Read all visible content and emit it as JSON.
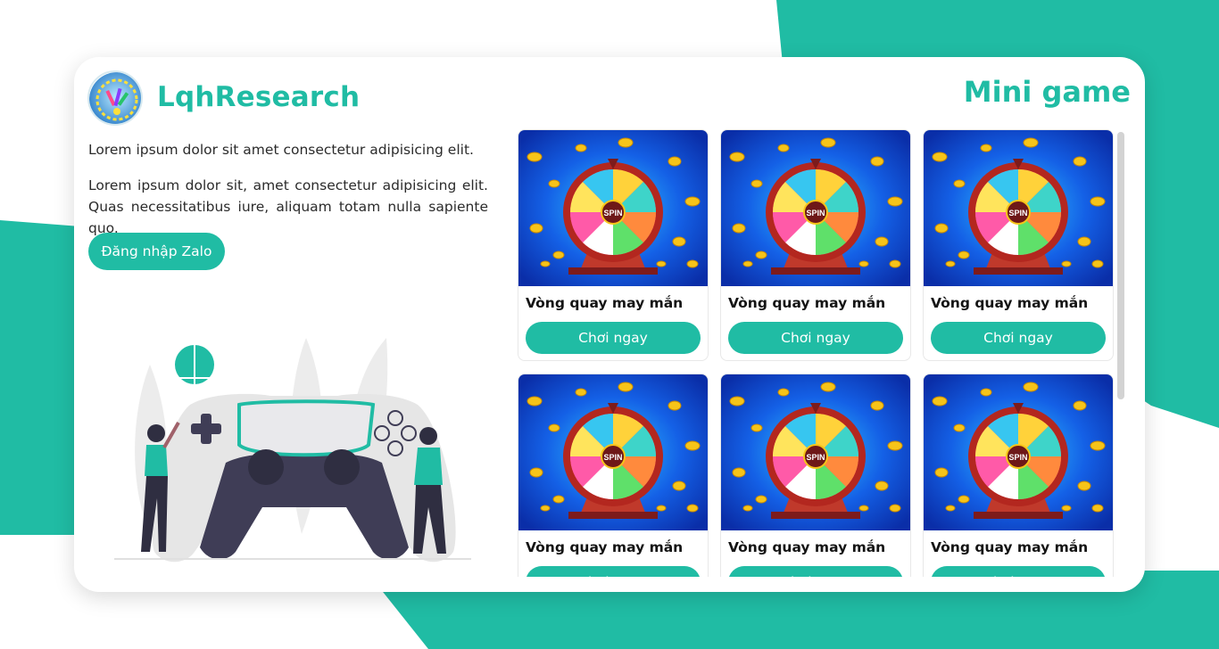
{
  "brand": {
    "name": "LqhResearch",
    "logo_icon": "lqhresearch-logo-icon"
  },
  "page_title": "Mini game",
  "intro": {
    "paragraph_1": "Lorem ipsum dolor sit amet consectetur adipisicing elit.",
    "paragraph_2": "Lorem ipsum dolor sit, amet consectetur adipisicing elit. Quas necessitatibus iure, aliquam totam nulla sapiente quo.",
    "login_button": "Đăng nhập Zalo"
  },
  "illustration_icon": "gamers-with-controller-illustration",
  "games": [
    {
      "name": "Vòng quay may mắn",
      "play_label": "Chơi ngay",
      "thumb_icon": "lucky-spin-wheel-icon",
      "thumb_text": "SPIN"
    },
    {
      "name": "Vòng quay may mắn",
      "play_label": "Chơi ngay",
      "thumb_icon": "lucky-spin-wheel-icon",
      "thumb_text": "SPIN"
    },
    {
      "name": "Vòng quay may mắn",
      "play_label": "Chơi ngay",
      "thumb_icon": "lucky-spin-wheel-icon",
      "thumb_text": "SPIN"
    },
    {
      "name": "Vòng quay may mắn",
      "play_label": "Chơi ngay",
      "thumb_icon": "lucky-spin-wheel-icon",
      "thumb_text": "SPIN"
    },
    {
      "name": "Vòng quay may mắn",
      "play_label": "Chơi ngay",
      "thumb_icon": "lucky-spin-wheel-icon",
      "thumb_text": "SPIN"
    },
    {
      "name": "Vòng quay may mắn",
      "play_label": "Chơi ngay",
      "thumb_icon": "lucky-spin-wheel-icon",
      "thumb_text": "SPIN"
    }
  ],
  "colors": {
    "accent": "#20bca4",
    "text": "#2b2b2b",
    "background": "#ffffff"
  }
}
